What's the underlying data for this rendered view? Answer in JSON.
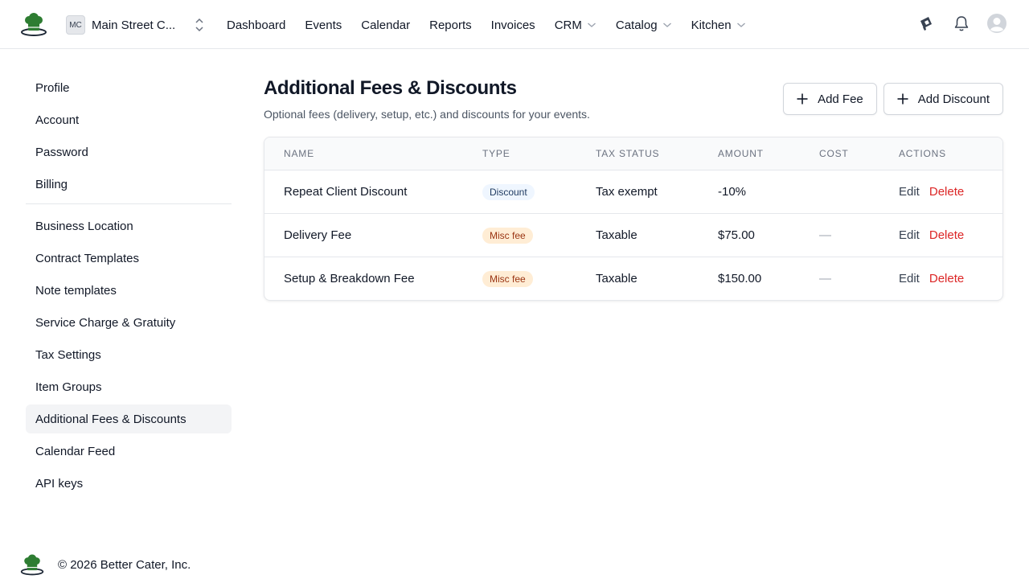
{
  "header": {
    "org_initials": "MC",
    "org_name": "Main Street C...",
    "nav": [
      {
        "label": "Dashboard",
        "has_dropdown": false
      },
      {
        "label": "Events",
        "has_dropdown": false
      },
      {
        "label": "Calendar",
        "has_dropdown": false
      },
      {
        "label": "Reports",
        "has_dropdown": false
      },
      {
        "label": "Invoices",
        "has_dropdown": false
      },
      {
        "label": "CRM",
        "has_dropdown": true
      },
      {
        "label": "Catalog",
        "has_dropdown": true
      },
      {
        "label": "Kitchen",
        "has_dropdown": true
      }
    ],
    "icons": [
      "megaphone-icon",
      "bell-icon",
      "user-avatar-icon"
    ]
  },
  "sidebar": {
    "group1": [
      "Profile",
      "Account",
      "Password",
      "Billing"
    ],
    "group2": [
      "Business Location",
      "Contract Templates",
      "Note templates",
      "Service Charge & Gratuity",
      "Tax Settings",
      "Item Groups",
      "Additional Fees & Discounts",
      "Calendar Feed",
      "API keys"
    ],
    "active": "Additional Fees & Discounts"
  },
  "main": {
    "title": "Additional Fees & Discounts",
    "subtitle": "Optional fees (delivery, setup, etc.) and discounts for your events.",
    "add_fee_label": "Add Fee",
    "add_discount_label": "Add Discount",
    "table": {
      "columns": [
        "NAME",
        "TYPE",
        "TAX STATUS",
        "AMOUNT",
        "COST",
        "ACTIONS"
      ],
      "rows": [
        {
          "name": "Repeat Client Discount",
          "type": "Discount",
          "tax_status": "Tax exempt",
          "amount": "-10%",
          "cost": "",
          "edit": "Edit",
          "delete": "Delete"
        },
        {
          "name": "Delivery Fee",
          "type": "Misc fee",
          "tax_status": "Taxable",
          "amount": "$75.00",
          "cost": "—",
          "edit": "Edit",
          "delete": "Delete"
        },
        {
          "name": "Setup & Breakdown Fee",
          "type": "Misc fee",
          "tax_status": "Taxable",
          "amount": "$150.00",
          "cost": "—",
          "edit": "Edit",
          "delete": "Delete"
        }
      ]
    }
  },
  "footer": {
    "text": "© 2026 Better Cater, Inc."
  },
  "colors": {
    "brand_green": "#2e7d32",
    "delete_red": "#dc2626",
    "discount_badge_bg": "#eff6ff",
    "misc_badge_bg": "#ffedd5"
  }
}
